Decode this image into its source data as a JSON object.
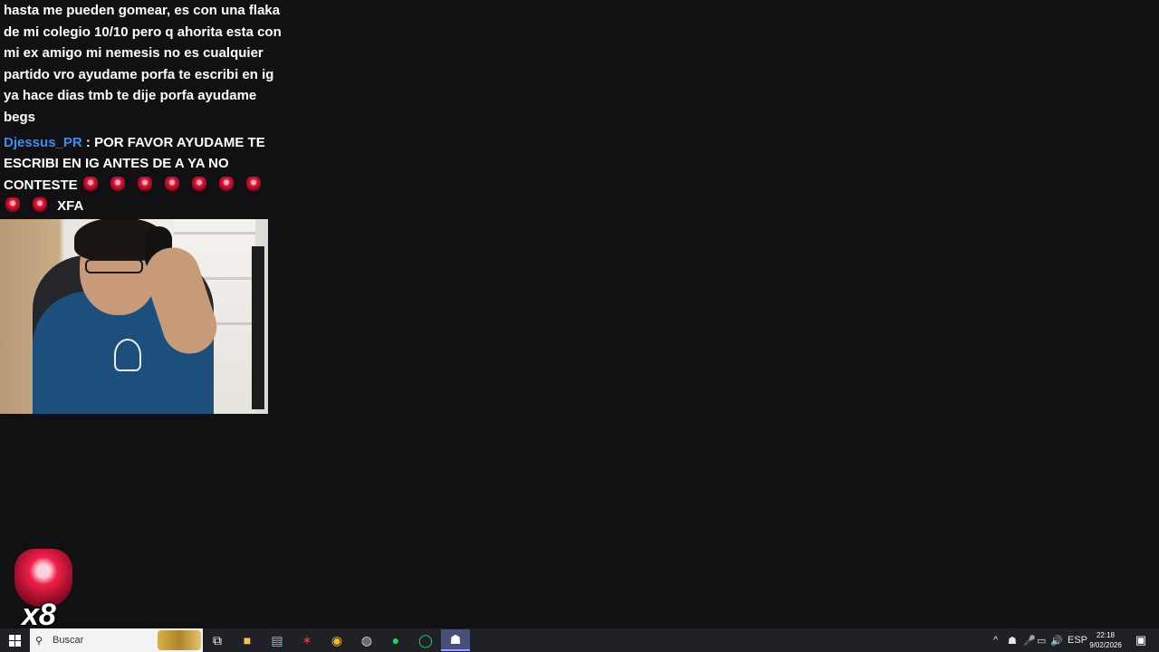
{
  "chat": {
    "message1": "hasta me pueden gomear, es con una flaka de mi colegio 10/10 pero q ahorita esta con mi ex amigo mi nemesis no es cualquier partido vro ayudame porfa te escribi en ig ya hace dias tmb te dije porfa ayudame begs",
    "message2": {
      "username": "Djessus_PR",
      "separator": ":",
      "text": "POR FAVOR AYUDAME TE ESCRIBI EN IG ANTES DE A YA NO CONTESTE",
      "trailing": "XFA",
      "emote_count": 9,
      "emote_icon": "red-gem-emote"
    },
    "colors": {
      "text": "#ffffff",
      "username": "#3a8df0"
    }
  },
  "webcam": {
    "icon": "streamer-webcam"
  },
  "badge": {
    "count": "x8",
    "icon": "red-gem-icon"
  },
  "taskbar": {
    "search_placeholder": "Buscar",
    "apps": [
      {
        "name": "task-view-icon",
        "glyph": "⧉"
      },
      {
        "name": "file-explorer-icon",
        "glyph": "📁"
      },
      {
        "name": "notepad-icon",
        "glyph": "▤"
      },
      {
        "name": "app-red-icon",
        "glyph": "✶"
      },
      {
        "name": "chrome-icon",
        "glyph": "◉"
      },
      {
        "name": "obs-icon",
        "glyph": "◍"
      },
      {
        "name": "spotify-icon",
        "glyph": "●"
      },
      {
        "name": "whatsapp-icon",
        "glyph": "◯"
      },
      {
        "name": "discord-icon",
        "glyph": "☗"
      }
    ],
    "tray": {
      "chevron": "^",
      "language": "ESP",
      "time": "22:18",
      "date": "9/02/2026"
    }
  }
}
